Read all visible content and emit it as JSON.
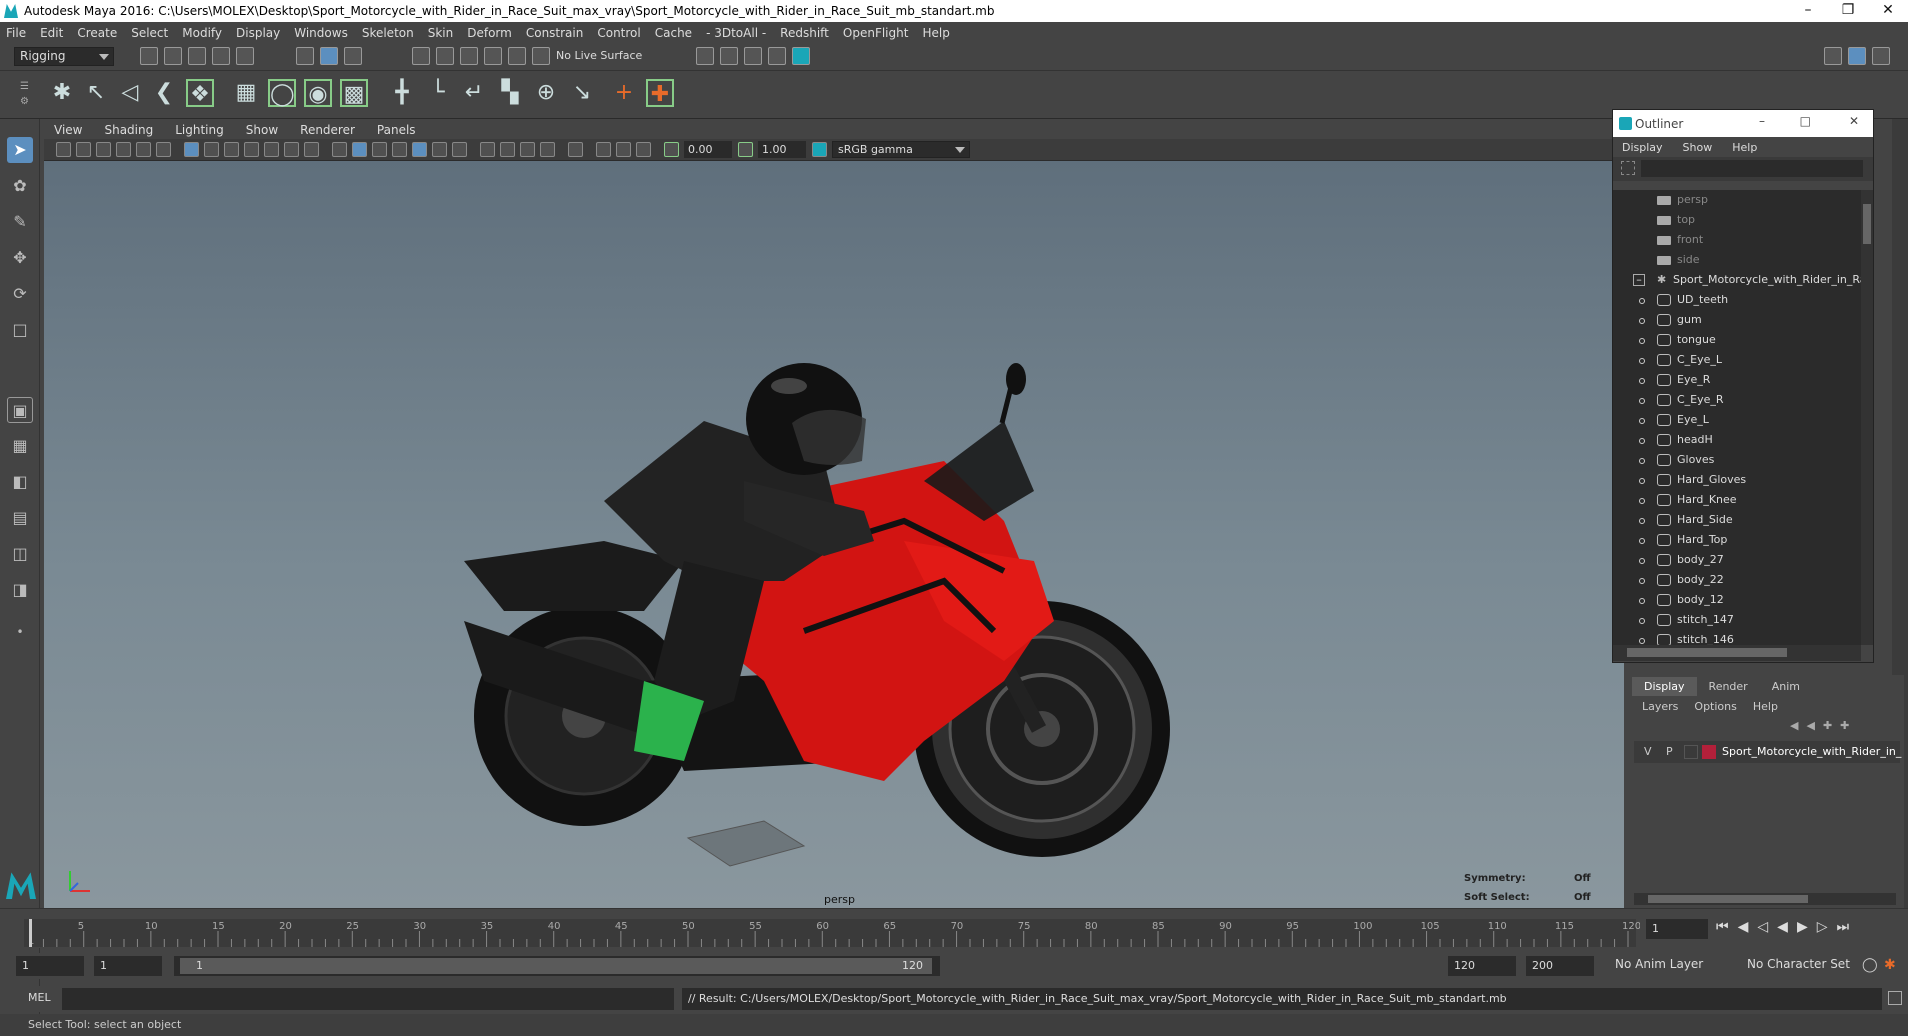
{
  "window": {
    "title": "Autodesk Maya 2016: C:\\Users\\MOLEX\\Desktop\\Sport_Motorcycle_with_Rider_in_Race_Suit_max_vray\\Sport_Motorcycle_with_Rider_in_Race_Suit_mb_standart.mb"
  },
  "menubar": [
    "File",
    "Edit",
    "Create",
    "Select",
    "Modify",
    "Display",
    "Windows",
    "Skeleton",
    "Skin",
    "Deform",
    "Constrain",
    "Control",
    "Cache",
    "- 3DtoAll -",
    "Redshift",
    "OpenFlight",
    "Help"
  ],
  "shelf": {
    "mode": "Rigging",
    "live_surface": "No Live Surface"
  },
  "viewport": {
    "menu": [
      "View",
      "Shading",
      "Lighting",
      "Show",
      "Renderer",
      "Panels"
    ],
    "exposure": "0.00",
    "gamma": "1.00",
    "color_space": "sRGB gamma",
    "camera_label": "persp",
    "symmetry_label": "Symmetry:",
    "symmetry_value": "Off",
    "soft_select_label": "Soft Select:",
    "soft_select_value": "Off"
  },
  "outliner": {
    "title": "Outliner",
    "menu": [
      "Display",
      "Show",
      "Help"
    ],
    "cameras": [
      "persp",
      "top",
      "front",
      "side"
    ],
    "root": "Sport_Motorcycle_with_Rider_in_Ra",
    "children": [
      "UD_teeth",
      "gum",
      "tongue",
      "C_Eye_L",
      "Eye_R",
      "C_Eye_R",
      "Eye_L",
      "headH",
      "Gloves",
      "Hard_Gloves",
      "Hard_Knee",
      "Hard_Side",
      "Hard_Top",
      "body_27",
      "body_22",
      "body_12",
      "stitch_147",
      "stitch_146"
    ]
  },
  "layer_editor": {
    "tabs": [
      "Display",
      "Render",
      "Anim"
    ],
    "menu": [
      "Layers",
      "Options",
      "Help"
    ],
    "layer": {
      "v": "V",
      "p": "P",
      "name": "Sport_Motorcycle_with_Rider_in_",
      "color": "#b3203a"
    }
  },
  "timeline": {
    "ticks": [
      "1",
      "5",
      "10",
      "15",
      "20",
      "25",
      "30",
      "35",
      "40",
      "45",
      "50",
      "55",
      "60",
      "65",
      "70",
      "75",
      "80",
      "85",
      "90",
      "95",
      "100",
      "105",
      "110",
      "115",
      "120"
    ],
    "current_frame": "1"
  },
  "range": {
    "start": "1",
    "playback_start": "1",
    "slider_start": "1",
    "slider_end": "120",
    "playback_end": "120",
    "end": "200",
    "anim_layer": "No Anim Layer",
    "character_set": "No Character Set"
  },
  "command": {
    "label": "MEL",
    "result": "// Result: C:/Users/MOLEX/Desktop/Sport_Motorcycle_with_Rider_in_Race_Suit_max_vray/Sport_Motorcycle_with_Rider_in_Race_Suit_mb_standart.mb"
  },
  "help_line": "Select Tool: select an object",
  "colors": {
    "accent": "#1aa6b7",
    "bike_red": "#d21412",
    "viewport_top": "#5f6f7c",
    "viewport_bottom": "#8a979e"
  }
}
